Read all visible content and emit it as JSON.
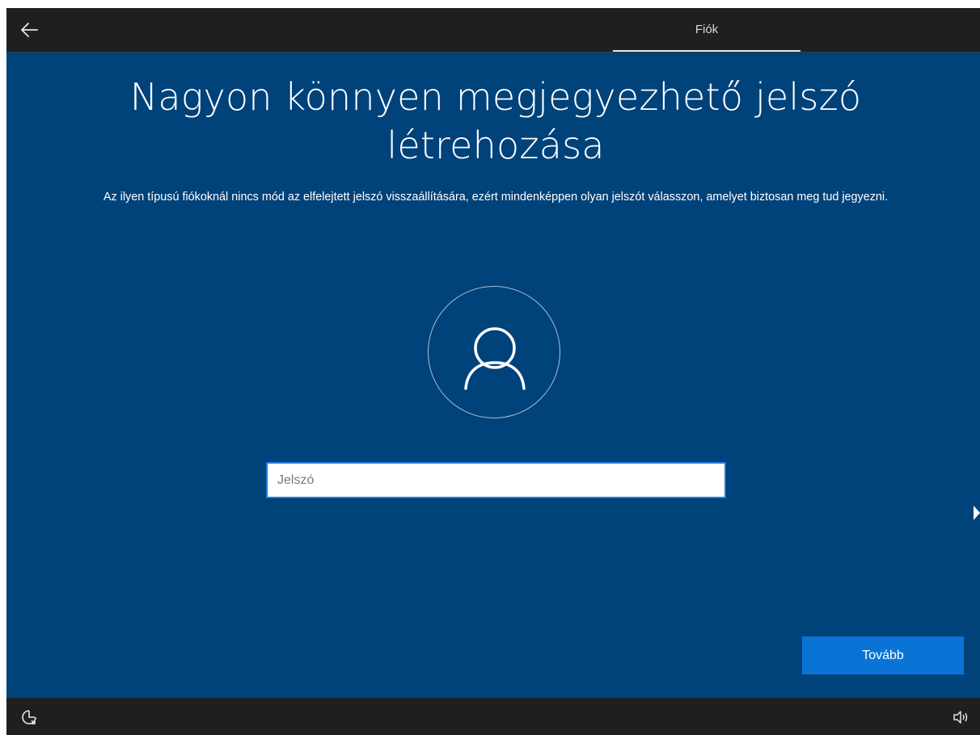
{
  "header": {
    "back_icon": "arrow-left-icon",
    "tab_label": "Fiók"
  },
  "main": {
    "title": "Nagyon könnyen megjegyezhető jelszó létrehozása",
    "subtitle": "Az ilyen típusú fiókoknál nincs mód az elfelejtett jelszó visszaállítására, ezért mindenképpen olyan jelszót válasszon, amelyet biztosan meg tud jegyezni.",
    "avatar_icon": "user-avatar-icon",
    "password": {
      "placeholder": "Jelszó",
      "value": ""
    },
    "next_label": "Tovább"
  },
  "footer": {
    "accessibility_icon": "ease-of-access-icon",
    "volume_icon": "speaker-volume-icon"
  },
  "colors": {
    "background": "#00427a",
    "bars": "#1f1f1f",
    "accent": "#0a74d6"
  }
}
